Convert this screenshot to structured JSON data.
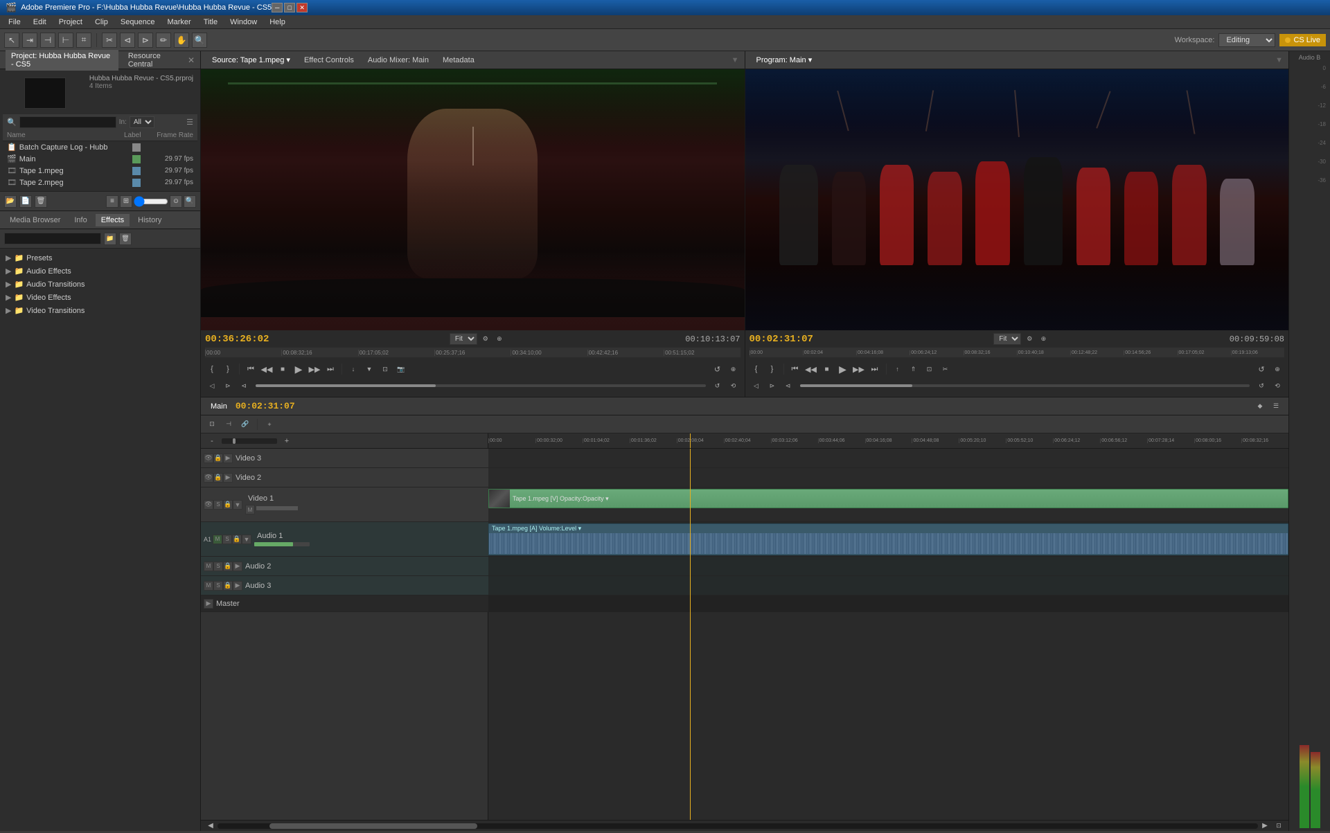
{
  "titleBar": {
    "title": "Adobe Premiere Pro - F:\\Hubba Hubba Revue\\Hubba Hubba Revue - CS5",
    "winControls": [
      "_",
      "□",
      "×"
    ]
  },
  "menuBar": {
    "items": [
      "File",
      "Edit",
      "Project",
      "Clip",
      "Sequence",
      "Marker",
      "Title",
      "Window",
      "Help"
    ]
  },
  "workspace": {
    "label": "Workspace:",
    "value": "Editing",
    "csLive": "CS Live"
  },
  "leftPanel": {
    "projectTab": "Project: Hubba Hubba Revue - CS5",
    "resourceTab": "Resource Central",
    "projectName": "Hubba Hubba Revue - CS5.prproj",
    "itemCount": "4 Items",
    "searchPlaceholder": "",
    "inLabel": "In:",
    "allLabel": "All",
    "tableHeaders": {
      "name": "Name",
      "label": "Label",
      "frameRate": "Frame Rate"
    },
    "items": [
      {
        "name": "Batch Capture Log - Hubb",
        "color": "#aaaaaa",
        "fps": ""
      },
      {
        "name": "Main",
        "color": "#5a9a5a",
        "fps": "29.97 fps"
      },
      {
        "name": "Tape 1.mpeg",
        "color": "#5a5aaa",
        "fps": "29.97 fps"
      },
      {
        "name": "Tape 2.mpeg",
        "color": "#5a5aaa",
        "fps": "29.97 fps"
      }
    ]
  },
  "effectsPanel": {
    "tabs": [
      "Media Browser",
      "Info",
      "Effects",
      "History"
    ],
    "activeTab": "Effects",
    "folders": [
      {
        "name": "Presets",
        "expanded": false
      },
      {
        "name": "Audio Effects",
        "expanded": false
      },
      {
        "name": "Audio Transitions",
        "expanded": false
      },
      {
        "name": "Video Effects",
        "expanded": false
      },
      {
        "name": "Video Transitions",
        "expanded": false
      }
    ]
  },
  "sourceMonitor": {
    "tabs": [
      "Source: Tape 1.mpeg ▾",
      "Effect Controls",
      "Audio Mixer: Main",
      "Metadata"
    ],
    "activeTab": "Source: Tape 1.mpeg ▾",
    "timecode": "00:36:26:02",
    "durationCode": "00:10:13:07",
    "fitLabel": "Fit",
    "rulerMarks": [
      "00:00",
      "00:08:32;16",
      "00:17:05;02",
      "00:25:37;16",
      "00:34:10;00",
      "00:42:42;16",
      "00:51:15;02"
    ]
  },
  "programMonitor": {
    "title": "Program: Main ▾",
    "timecode": "00:02:31:07",
    "durationCode": "00:09:59:08",
    "fitLabel": "Fit",
    "rulerMarks": [
      "00:00",
      "00:02:04",
      "00:04:16;08",
      "00:06:24;12",
      "00:08:32;16",
      "00:10:40;18",
      "00:12:48;22",
      "00:14:56;26",
      "00:17:05;02",
      "00:19:13;06"
    ]
  },
  "timeline": {
    "name": "Main",
    "timecode": "00:02:31:07",
    "rulerMarks": [
      "00:00",
      "00:00:32;00",
      "00:01:04;02",
      "00:01:36;02",
      "00:02:08;04",
      "00:02:40;04",
      "00:03:12;06",
      "00:03:44;06",
      "00:04:16;08",
      "00:04:48;08",
      "00:05:20;10",
      "00:05:52;10",
      "00:06:24;12",
      "00:06:56;12",
      "00:07:28;14",
      "00:08:00;16",
      "00:08:32;16"
    ],
    "tracks": [
      {
        "type": "video",
        "name": "Video 3",
        "clips": []
      },
      {
        "type": "video",
        "name": "Video 2",
        "clips": []
      },
      {
        "type": "video",
        "name": "Video 1",
        "clips": [
          {
            "label": "Tape 1.mpeg [V]  Opacity:Opacity ▾",
            "start": 0,
            "width": 90
          }
        ]
      },
      {
        "type": "audio",
        "name": "Audio 1",
        "clips": [
          {
            "label": "Tape 1.mpeg [A]  Volume:Level ▾",
            "start": 0,
            "width": 90
          }
        ]
      },
      {
        "type": "audio",
        "name": "Audio 2",
        "clips": []
      },
      {
        "type": "audio",
        "name": "Audio 3",
        "clips": []
      },
      {
        "type": "master",
        "name": "Master",
        "clips": []
      }
    ]
  },
  "audioMeter": {
    "label": "Audio B",
    "scales": [
      "0",
      "-6",
      "-12",
      "-18",
      "-24",
      "-30",
      "-36"
    ]
  },
  "icons": {
    "play": "▶",
    "pause": "⏸",
    "stepBack": "⏮",
    "stepForward": "⏭",
    "rewind": "◀◀",
    "ffwd": "▶▶",
    "loop": "↺",
    "mark_in": "[",
    "mark_out": "]",
    "lift": "↑",
    "extract": "⌃",
    "insert": "↓",
    "overwrite": "⊻",
    "folder": "📁",
    "arrow_right": "▶",
    "arrow_down": "▼",
    "film": "🎬",
    "search": "🔍",
    "new_bin": "📂",
    "trash": "🗑",
    "list": "≡",
    "icon_view": "⊞",
    "settings": "⚙",
    "close": "✕",
    "minimize": "─",
    "maximize": "□"
  }
}
